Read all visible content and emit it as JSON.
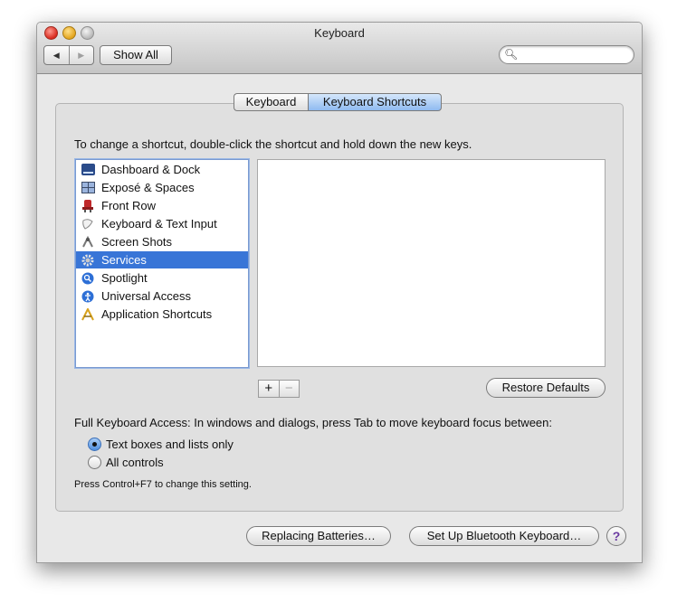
{
  "window": {
    "title": "Keyboard"
  },
  "toolbar": {
    "back_label": "◀",
    "forward_label": "▶",
    "show_all_label": "Show All",
    "search_placeholder": "",
    "search_icon": "search-icon"
  },
  "tabs": [
    {
      "label": "Keyboard",
      "selected": false
    },
    {
      "label": "Keyboard Shortcuts",
      "selected": true
    }
  ],
  "instructions": "To change a shortcut, double-click the shortcut and hold down the new keys.",
  "categories": [
    {
      "label": "Dashboard & Dock",
      "icon": "dashboard-dock-icon",
      "selected": false
    },
    {
      "label": "Exposé & Spaces",
      "icon": "expose-spaces-icon",
      "selected": false
    },
    {
      "label": "Front Row",
      "icon": "front-row-icon",
      "selected": false
    },
    {
      "label": "Keyboard & Text Input",
      "icon": "keyboard-text-input-icon",
      "selected": false
    },
    {
      "label": "Screen Shots",
      "icon": "screen-shots-icon",
      "selected": false
    },
    {
      "label": "Services",
      "icon": "services-gear-icon",
      "selected": true
    },
    {
      "label": "Spotlight",
      "icon": "spotlight-icon",
      "selected": false
    },
    {
      "label": "Universal Access",
      "icon": "universal-access-icon",
      "selected": false
    },
    {
      "label": "Application Shortcuts",
      "icon": "application-shortcuts-icon",
      "selected": false
    }
  ],
  "list_controls": {
    "add_label": "+",
    "remove_label": "−"
  },
  "restore_defaults_label": "Restore Defaults",
  "full_keyboard_access": {
    "label": "Full Keyboard Access: In windows and dialogs, press Tab to move keyboard focus between:",
    "options": [
      {
        "label": "Text boxes and lists only",
        "selected": true
      },
      {
        "label": "All controls",
        "selected": false
      }
    ],
    "hint": "Press Control+F7 to change this setting."
  },
  "footer": {
    "replacing_batteries_label": "Replacing Batteries…",
    "bluetooth_label": "Set Up Bluetooth Keyboard…",
    "help_label": "?"
  },
  "colors": {
    "selection": "#3875d7",
    "tab_selected": "#8fbaf0"
  }
}
